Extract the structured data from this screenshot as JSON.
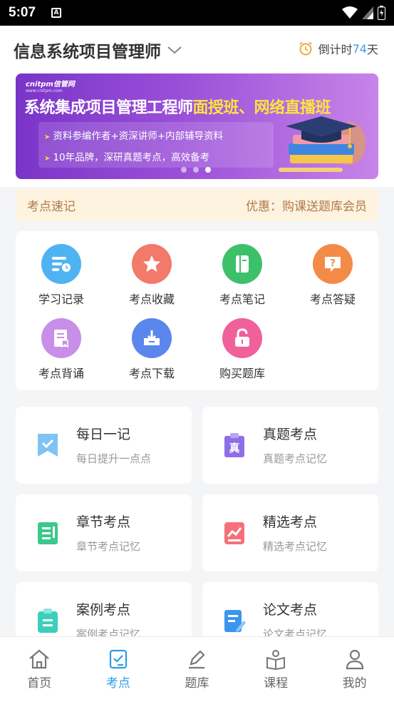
{
  "status_bar": {
    "time": "5:07",
    "a_icon": "A"
  },
  "header": {
    "title": "信息系统项目管理师",
    "countdown_prefix": "倒计时",
    "countdown_days": "74",
    "countdown_suffix": "天"
  },
  "banner": {
    "logo": "cnitpm信管网",
    "logo_url": "www.cnitpm.com",
    "headline_main": "系统集成项目管理工程师",
    "headline_highlight": "面授班、网络直播班",
    "point1": "资料参编作者+资深讲师+内部辅导资料",
    "point2": "10年品牌，深研真题考点，高效备考",
    "colors": {
      "bg_start": "#7a34c8",
      "bg_end": "#c784e8",
      "highlight": "#ffe23f"
    }
  },
  "promo": {
    "left": "考点速记",
    "right": "优惠：购课送题库会员"
  },
  "grid": [
    {
      "label": "学习记录",
      "icon": "study-record-icon",
      "color": "#4fb3f2"
    },
    {
      "label": "考点收藏",
      "icon": "star-icon",
      "color": "#f27a6a"
    },
    {
      "label": "考点笔记",
      "icon": "notebook-icon",
      "color": "#3cc06a"
    },
    {
      "label": "考点答疑",
      "icon": "question-icon",
      "color": "#f48a47"
    },
    {
      "label": "考点背诵",
      "icon": "recite-icon",
      "color": "#c98ee8"
    },
    {
      "label": "考点下载",
      "icon": "download-icon",
      "color": "#5b86ec"
    },
    {
      "label": "购买题库",
      "icon": "lock-icon",
      "color": "#f0609a"
    }
  ],
  "features": [
    {
      "title": "每日一记",
      "sub": "每日提升一点点",
      "icon": "bookmark-check-icon"
    },
    {
      "title": "真题考点",
      "sub": "真题考点记忆",
      "icon": "clipboard-zhen-icon"
    },
    {
      "title": "章节考点",
      "sub": "章节考点记忆",
      "icon": "chapter-list-icon"
    },
    {
      "title": "精选考点",
      "sub": "精选考点记忆",
      "icon": "trend-chart-icon"
    },
    {
      "title": "案例考点",
      "sub": "案例考点记忆",
      "icon": "clipboard-icon"
    },
    {
      "title": "论文考点",
      "sub": "论文考点记忆",
      "icon": "document-edit-icon"
    }
  ],
  "nav": [
    {
      "label": "首页",
      "icon": "home-icon",
      "active": false
    },
    {
      "label": "考点",
      "icon": "checklist-icon",
      "active": true
    },
    {
      "label": "题库",
      "icon": "pen-icon",
      "active": false
    },
    {
      "label": "课程",
      "icon": "book-user-icon",
      "active": false
    },
    {
      "label": "我的",
      "icon": "user-icon",
      "active": false
    }
  ]
}
